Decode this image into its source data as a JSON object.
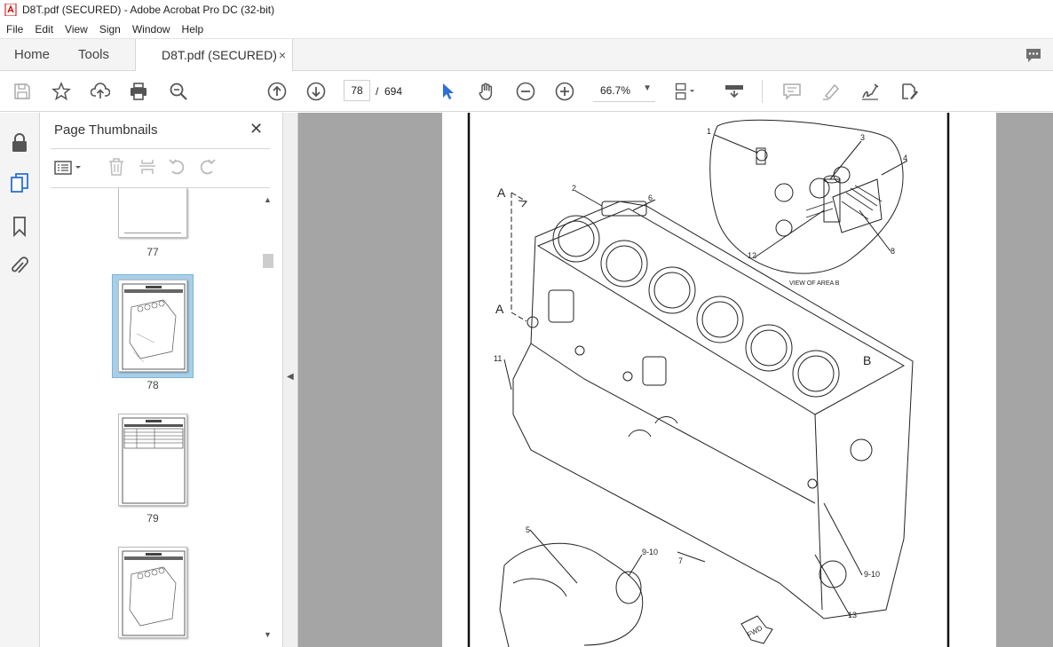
{
  "window": {
    "title": "D8T.pdf (SECURED) - Adobe Acrobat Pro DC (32-bit)"
  },
  "menu": [
    "File",
    "Edit",
    "View",
    "Sign",
    "Window",
    "Help"
  ],
  "tabs": {
    "home": "Home",
    "tools": "Tools",
    "document": "D8T.pdf (SECURED)",
    "close": "×"
  },
  "toolbar": {
    "current_page": "78",
    "page_separator": "/",
    "total_pages": "694",
    "zoom": "66.7%",
    "icons": [
      "save-icon",
      "bookmark-star-icon",
      "upload-icon",
      "print-icon",
      "zoom-search-icon",
      "prev-page-icon",
      "next-page-icon",
      "select-pointer-icon",
      "hand-icon",
      "zoom-out-icon",
      "zoom-in-icon",
      "fit-page-icon",
      "scroll-mode-icon",
      "comment-icon",
      "highlight-icon",
      "sign-icon",
      "fill-sign-icon"
    ]
  },
  "sidebar": {
    "icons": [
      "lock-icon",
      "pages-icon",
      "bookmark-icon",
      "attachment-icon"
    ]
  },
  "thumbnails_panel": {
    "title": "Page Thumbnails",
    "close": "✕",
    "thumbnails": [
      {
        "label": "77"
      },
      {
        "label": "78",
        "selected": true
      },
      {
        "label": "79"
      }
    ]
  },
  "drawing": {
    "labels": {
      "view_a_top": "A",
      "view_a_bottom": "A",
      "view_b": "B",
      "view_of_area_b": "VIEW OF AREA B",
      "fwd": "FWD"
    },
    "callouts": [
      "1",
      "2",
      "3",
      "4",
      "5",
      "6",
      "7",
      "8",
      "9-10",
      "9-10",
      "11",
      "12",
      "13"
    ]
  }
}
